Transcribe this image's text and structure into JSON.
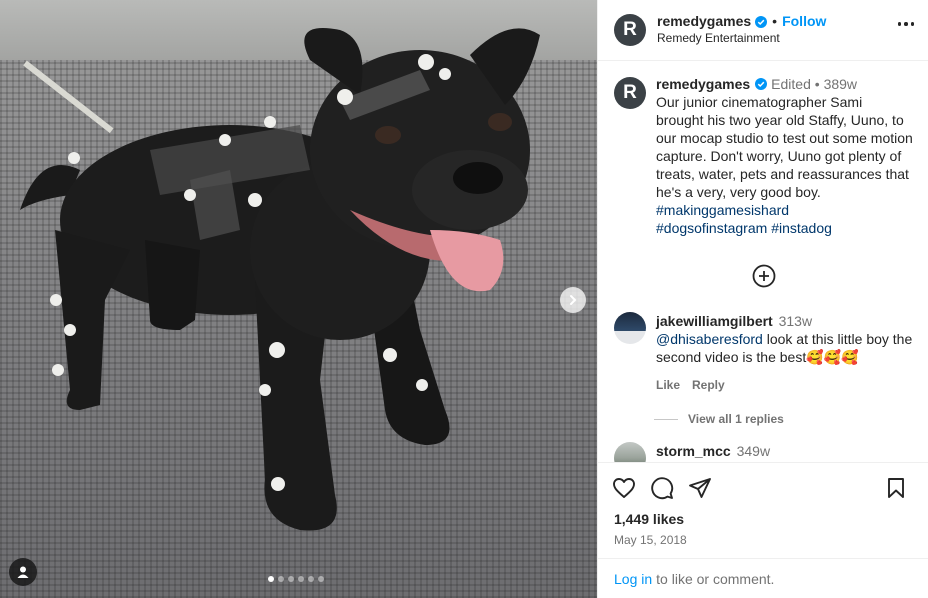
{
  "post": {
    "username": "remedygames",
    "follow_label": "Follow",
    "dot_sep": "•",
    "full_name": "Remedy Entertainment",
    "avatar_letter": "R"
  },
  "caption": {
    "username": "remedygames",
    "edited": "Edited",
    "dot_sep": "•",
    "time": "389w",
    "text": "Our junior cinematographer Sami brought his two year old Staffy, Uuno, to our mocap studio to test out some motion capture. Don't worry, Uuno got plenty of treats, water, pets and reassurances that he's a very, very good boy. ",
    "hashtags": [
      "#makinggamesishard",
      "#dogsofinstagram",
      "#instadog"
    ]
  },
  "comments": [
    {
      "username": "jakewilliamgilbert",
      "time": "313w",
      "mention": "@dhisaberesford",
      "text": " look at this little boy the second video is the best🥰🥰🥰",
      "like_label": "Like",
      "reply_label": "Reply",
      "view_replies": "View all 1 replies"
    },
    {
      "username": "storm_mcc",
      "time": "349w"
    }
  ],
  "stats": {
    "likes": "1,449 likes",
    "date": "May 15, 2018"
  },
  "footer": {
    "login_link": "Log in",
    "login_text": "to like or comment."
  },
  "carousel": {
    "slide_count": 6,
    "active_index": 0
  },
  "icons": {
    "verified": "verified-badge-icon",
    "more": "more-options-icon",
    "next": "chevron-right-icon",
    "tag": "user-tag-icon",
    "load_more": "plus-circle-icon",
    "like": "heart-icon",
    "comment": "comment-bubble-icon",
    "share": "paper-plane-icon",
    "save": "bookmark-icon"
  },
  "colors": {
    "link_blue": "#0095f6",
    "hashtag": "#00376b",
    "gray_text": "#737373",
    "verified": "#0095f6"
  }
}
